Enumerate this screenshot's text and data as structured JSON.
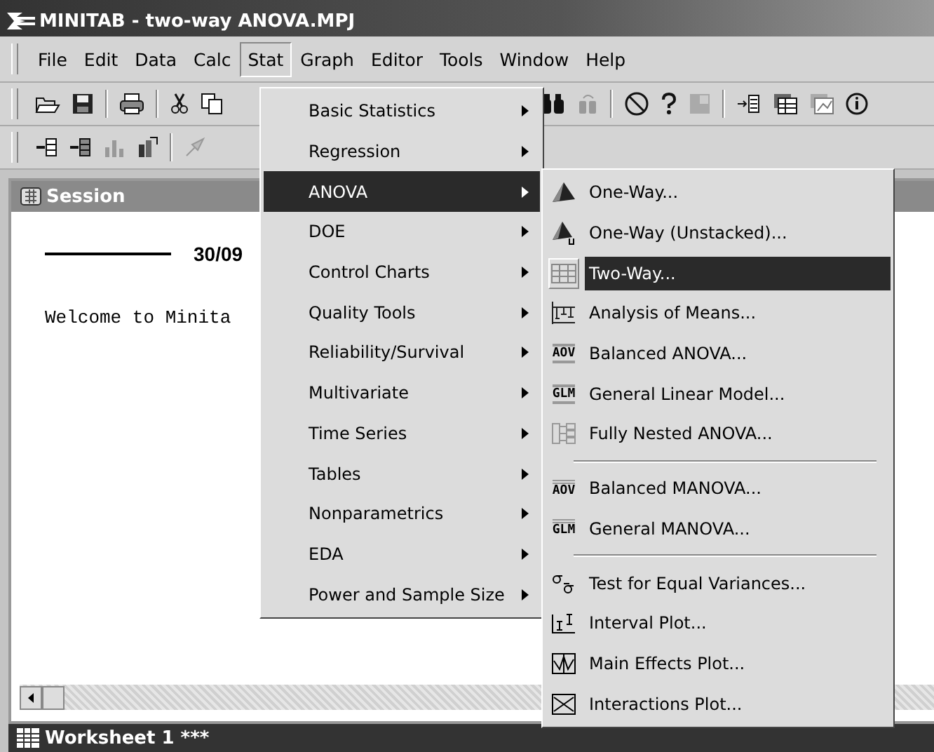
{
  "window": {
    "title": "MINITAB - two-way ANOVA.MPJ"
  },
  "menu_bar": [
    {
      "label": "File",
      "selected": false
    },
    {
      "label": "Edit",
      "selected": false
    },
    {
      "label": "Data",
      "selected": false
    },
    {
      "label": "Calc",
      "selected": false
    },
    {
      "label": "Stat",
      "selected": true
    },
    {
      "label": "Graph",
      "selected": false
    },
    {
      "label": "Editor",
      "selected": false
    },
    {
      "label": "Tools",
      "selected": false
    },
    {
      "label": "Window",
      "selected": false
    },
    {
      "label": "Help",
      "selected": false
    }
  ],
  "session": {
    "title": "Session",
    "date_heading": "30/09",
    "welcome_text": "Welcome to Minita"
  },
  "stat_menu": [
    {
      "label": "Basic Statistics",
      "selected": false
    },
    {
      "label": "Regression",
      "selected": false
    },
    {
      "label": "ANOVA",
      "selected": true
    },
    {
      "label": "DOE",
      "selected": false
    },
    {
      "label": "Control Charts",
      "selected": false
    },
    {
      "label": "Quality Tools",
      "selected": false
    },
    {
      "label": "Reliability/Survival",
      "selected": false
    },
    {
      "label": "Multivariate",
      "selected": false
    },
    {
      "label": "Time Series",
      "selected": false
    },
    {
      "label": "Tables",
      "selected": false
    },
    {
      "label": "Nonparametrics",
      "selected": false
    },
    {
      "label": "EDA",
      "selected": false
    },
    {
      "label": "Power and Sample Size",
      "selected": false
    }
  ],
  "anova_menu": [
    {
      "kind": "item",
      "label": "One-Way...",
      "selected": false
    },
    {
      "kind": "item",
      "label": "One-Way (Unstacked)...",
      "selected": false
    },
    {
      "kind": "item",
      "label": "Two-Way...",
      "selected": true
    },
    {
      "kind": "item",
      "label": "Analysis of Means...",
      "selected": false
    },
    {
      "kind": "text_icon_item",
      "icon_text": "AOV",
      "label": "Balanced ANOVA...",
      "selected": false
    },
    {
      "kind": "text_icon_item",
      "icon_text": "GLM",
      "label": "General Linear Model...",
      "selected": false
    },
    {
      "kind": "item",
      "label": "Fully Nested ANOVA...",
      "selected": false
    },
    {
      "kind": "separator"
    },
    {
      "kind": "text_icon_item",
      "icon_text": "AOV",
      "label": "Balanced MANOVA...",
      "selected": false
    },
    {
      "kind": "text_icon_item",
      "icon_text": "GLM",
      "label": "General MANOVA...",
      "selected": false
    },
    {
      "kind": "separator"
    },
    {
      "kind": "item",
      "label": "Test for Equal Variances...",
      "selected": false
    },
    {
      "kind": "item",
      "label": "Interval Plot...",
      "selected": false
    },
    {
      "kind": "item",
      "label": "Main Effects Plot...",
      "selected": false
    },
    {
      "kind": "item",
      "label": "Interactions Plot...",
      "selected": false
    }
  ],
  "worksheet": {
    "title": "Worksheet 1 ***"
  }
}
